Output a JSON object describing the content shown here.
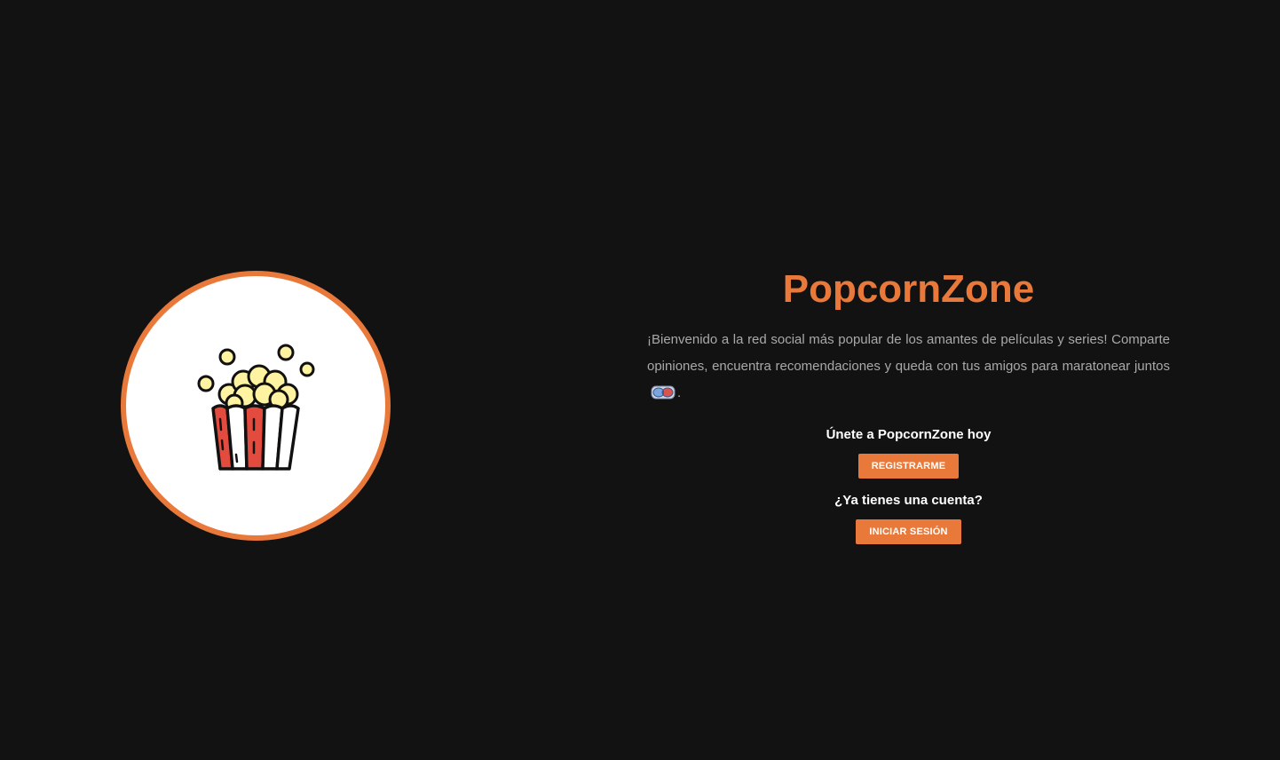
{
  "brand": {
    "title": "PopcornZone",
    "logo_icon": "popcorn-bucket-icon",
    "accent_color": "#e8793a",
    "background_color": "#121212"
  },
  "intro": {
    "text": "¡Bienvenido a la red social más popular de los amantes de películas y series! Comparte opiniones, encuentra recomendaciones y queda con tus amigos para maratonear juntos",
    "emoji_icon": "3d-glasses-icon",
    "trailing": "."
  },
  "signup": {
    "heading": "Únete a PopcornZone hoy",
    "button_label": "REGISTRARME"
  },
  "login": {
    "heading": "¿Ya tienes una cuenta?",
    "button_label": "INICIAR SESIÓN"
  }
}
